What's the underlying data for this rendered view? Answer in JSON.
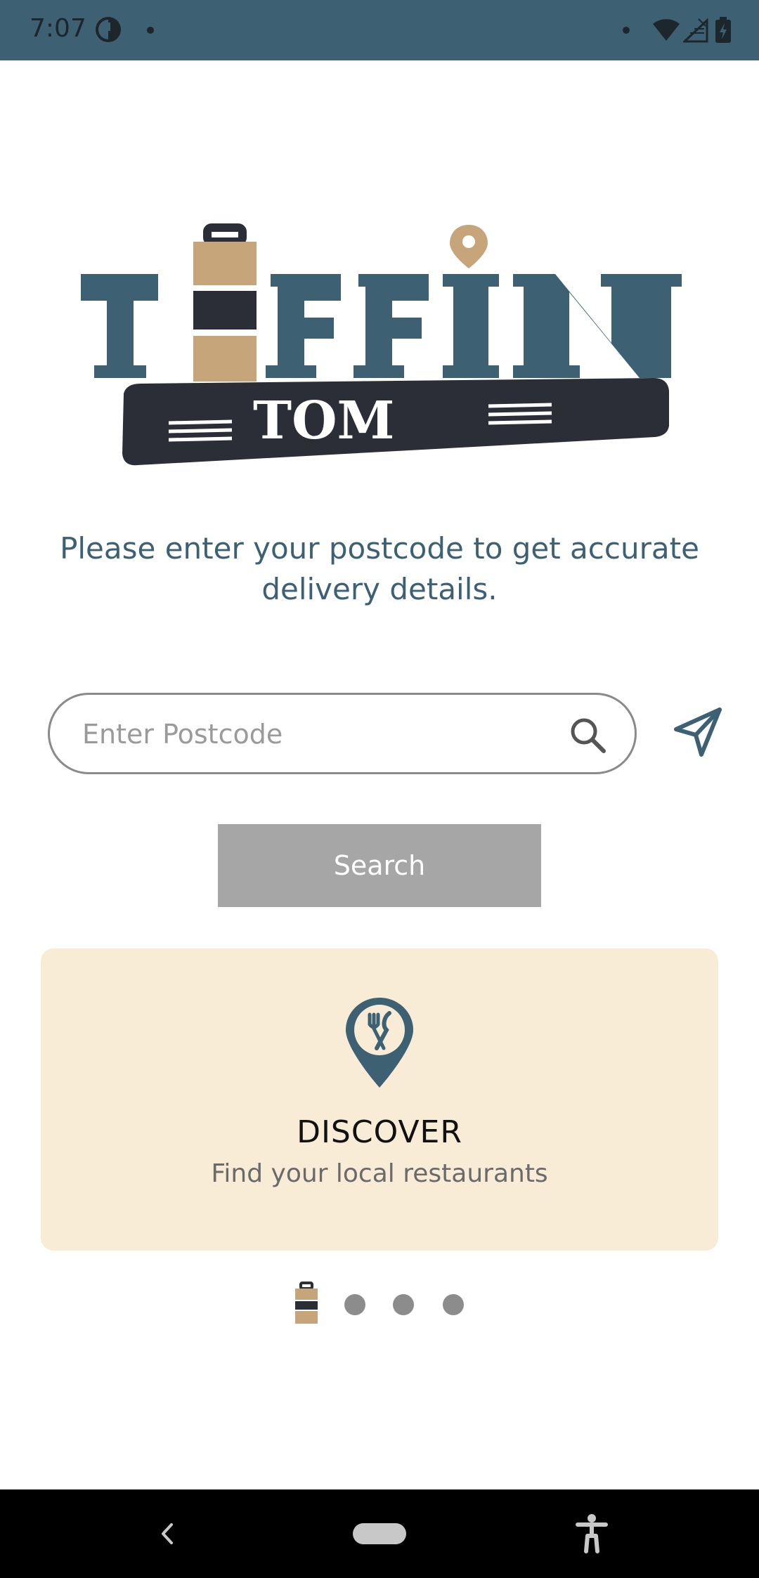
{
  "status_bar": {
    "time": "7:07",
    "background": "#3d6172",
    "icons": [
      "data-saver-icon",
      "notification-dot-icon",
      "wifi-icon",
      "signal-icon",
      "battery-charging-icon"
    ]
  },
  "logo": {
    "brand_word": "TIFFIN",
    "sub_word": "TOM",
    "colors": {
      "primary": "#3d6172",
      "accent": "#c7a57a",
      "dark": "#2b2e36"
    }
  },
  "instruction": {
    "text": "Please enter your postcode to get accurate delivery details."
  },
  "postcode": {
    "placeholder": "Enter Postcode",
    "value": "",
    "search_icon": "search-icon",
    "locate_icon": "send-location-icon"
  },
  "search_button": {
    "label": "Search",
    "background": "#a7a6a7"
  },
  "card": {
    "icon": "restaurant-pin-icon",
    "title": "DISCOVER",
    "subtitle": "Find your local restaurants",
    "background": "#f8ecd6"
  },
  "pager": {
    "total": 4,
    "active_index": 0,
    "active_icon": "tiffin-box-icon"
  },
  "nav_bar": {
    "icons": [
      "back-icon",
      "home-pill-icon",
      "accessibility-icon"
    ]
  }
}
